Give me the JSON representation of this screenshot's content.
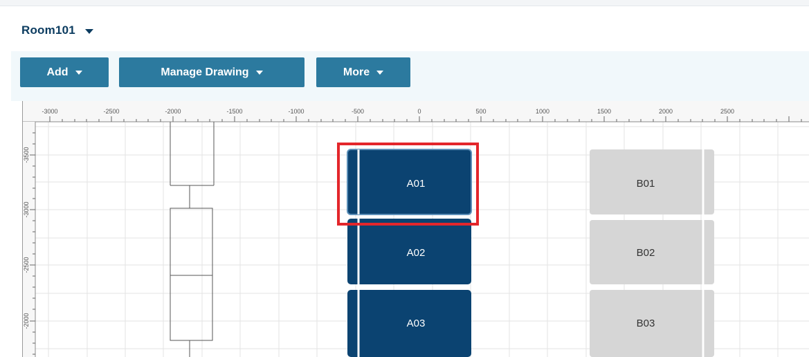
{
  "room": {
    "name": "Room101"
  },
  "toolbar": {
    "add_label": "Add",
    "manage_drawing_label": "Manage Drawing",
    "more_label": "More"
  },
  "ruler": {
    "x_ticks": [
      "-3000",
      "-2500",
      "-2000",
      "-1500",
      "-1000",
      "-500",
      "0",
      "500",
      "1000",
      "1500",
      "2000",
      "2500"
    ],
    "y_ticks": [
      "-3500",
      "-3000",
      "-2500",
      "-2000"
    ]
  },
  "racks": [
    {
      "label": "A01",
      "state": "selected"
    },
    {
      "label": "A02",
      "state": "filled"
    },
    {
      "label": "A03",
      "state": "filled"
    },
    {
      "label": "B01",
      "state": "empty"
    },
    {
      "label": "B02",
      "state": "empty"
    },
    {
      "label": "B03",
      "state": "empty"
    }
  ],
  "colors": {
    "rack_filled": "#0b4371",
    "rack_empty": "#d6d6d6",
    "selection": "#e3262b",
    "toolbar_button": "#2c7a9f",
    "title": "#0c3c60"
  }
}
